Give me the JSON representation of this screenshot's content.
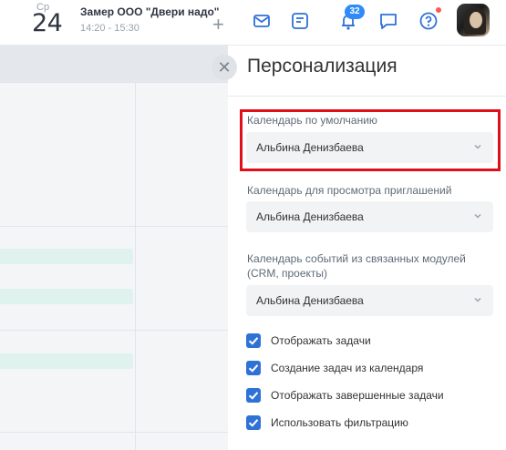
{
  "header": {
    "weekday": "Ср",
    "day": "24",
    "event_title": "Замер ООО \"Двери надо\"",
    "event_time": "14:20 - 15:30",
    "add_symbol": "+",
    "notifications_count": "32",
    "icons": [
      "mail-icon",
      "tasks-icon",
      "bell-icon",
      "chat-icon",
      "help-icon"
    ],
    "accent_color": "#2f8bf7"
  },
  "panel": {
    "close_symbol": "✕",
    "title": "Персонализация",
    "fields": [
      {
        "label": "Календарь по умолчанию",
        "value": "Альбина Денизбаева"
      },
      {
        "label": "Календарь для просмотра приглашений",
        "value": "Альбина Денизбаева"
      },
      {
        "label": "Календарь событий из связанных модулей (CRM, проекты)",
        "value": "Альбина Денизбаева"
      }
    ],
    "checkboxes": [
      {
        "label": "Отображать задачи",
        "checked": true
      },
      {
        "label": "Создание задач из календаря",
        "checked": true
      },
      {
        "label": "Отображать завершенные задачи",
        "checked": true
      },
      {
        "label": "Использовать фильтрацию",
        "checked": true
      }
    ],
    "highlight_color": "#e0101b",
    "checkbox_color": "#2f72d6"
  }
}
